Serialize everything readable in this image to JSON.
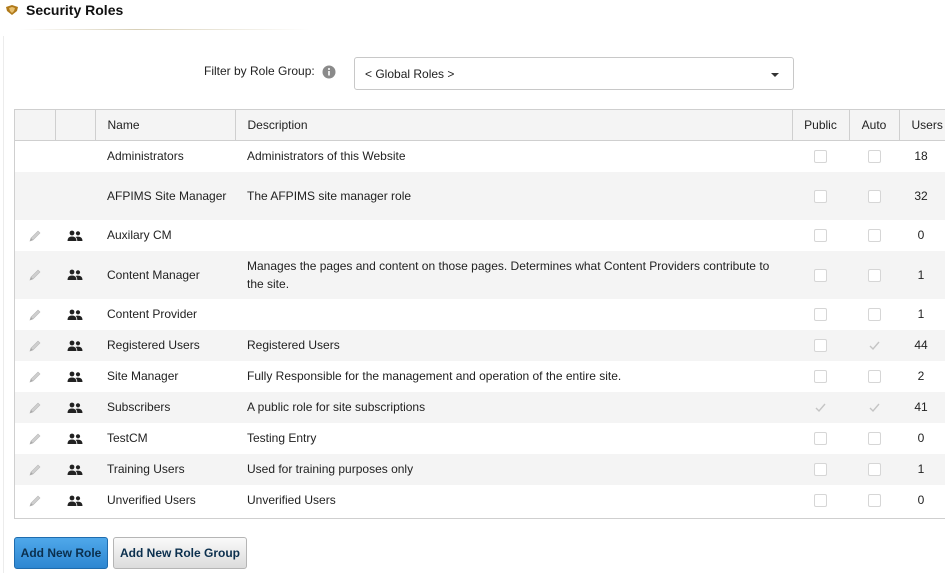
{
  "header": {
    "title": "Security Roles",
    "icon": "module-badge-icon",
    "accent": "#b07a1a"
  },
  "filter": {
    "label": "Filter by Role Group:",
    "selected": "< Global Roles >"
  },
  "grid": {
    "columns": {
      "name": "Name",
      "description": "Description",
      "public": "Public",
      "auto": "Auto",
      "users": "Users"
    },
    "rows": [
      {
        "name": "Administrators",
        "description": "Administrators of this Website",
        "public": false,
        "auto": false,
        "users": "18",
        "editable": false
      },
      {
        "name": "AFPIMS Site Manager",
        "description": "The AFPIMS site manager role",
        "public": false,
        "auto": false,
        "users": "32",
        "editable": false
      },
      {
        "name": "Auxilary CM",
        "description": "",
        "public": false,
        "auto": false,
        "users": "0",
        "editable": true
      },
      {
        "name": "Content Manager",
        "description": "Manages the pages and content on those pages. Determines what Content Providers contribute to the site.",
        "public": false,
        "auto": false,
        "users": "1",
        "editable": true
      },
      {
        "name": "Content Provider",
        "description": "",
        "public": false,
        "auto": false,
        "users": "1",
        "editable": true
      },
      {
        "name": "Registered Users",
        "description": "Registered Users",
        "public": false,
        "auto": true,
        "users": "44",
        "editable": true
      },
      {
        "name": "Site Manager",
        "description": "Fully Responsible for the management and operation of the entire site.",
        "public": false,
        "auto": false,
        "users": "2",
        "editable": true
      },
      {
        "name": "Subscribers",
        "description": "A public role for site subscriptions",
        "public": true,
        "auto": true,
        "users": "41",
        "editable": true
      },
      {
        "name": "TestCM",
        "description": "Testing Entry",
        "public": false,
        "auto": false,
        "users": "0",
        "editable": true
      },
      {
        "name": "Training Users",
        "description": "Used for training purposes only",
        "public": false,
        "auto": false,
        "users": "1",
        "editable": true
      },
      {
        "name": "Unverified Users",
        "description": "Unverified Users",
        "public": false,
        "auto": false,
        "users": "0",
        "editable": true
      }
    ]
  },
  "actions": {
    "add_role": "Add New Role",
    "add_role_group": "Add New Role Group"
  }
}
